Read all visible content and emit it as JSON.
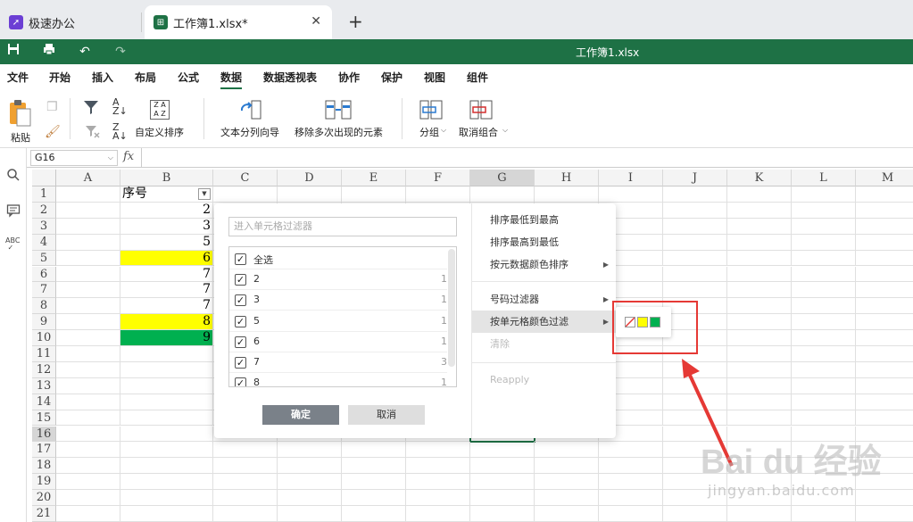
{
  "tabs": [
    {
      "label": "极速办公",
      "active": false
    },
    {
      "label": "工作簿1.xlsx*",
      "active": true
    }
  ],
  "new_tab_symbol": "+",
  "window_title": "工作簿1.xlsx",
  "menu": [
    "文件",
    "开始",
    "插入",
    "布局",
    "公式",
    "数据",
    "数据透视表",
    "协作",
    "保护",
    "视图",
    "组件"
  ],
  "active_menu": "数据",
  "ribbon": {
    "paste": "粘贴",
    "custom_sort": "自定义排序",
    "text_to_columns": "文本分列向导",
    "remove_duplicates": "移除多次出现的元素",
    "group": "分组",
    "ungroup": "取消组合"
  },
  "namebox": "G16",
  "fx": "fx",
  "columns": [
    "A",
    "B",
    "C",
    "D",
    "E",
    "F",
    "G",
    "H",
    "I",
    "J",
    "K",
    "L",
    "M"
  ],
  "selected_column": "G",
  "rows": [
    "1",
    "2",
    "3",
    "4",
    "5",
    "6",
    "7",
    "8",
    "9",
    "10",
    "11",
    "12",
    "13",
    "14",
    "15",
    "16",
    "17",
    "18",
    "19",
    "20",
    "21"
  ],
  "selected_row": "16",
  "b_header": "序号",
  "b_values": [
    {
      "value": "2",
      "fill": ""
    },
    {
      "value": "3",
      "fill": ""
    },
    {
      "value": "5",
      "fill": ""
    },
    {
      "value": "6",
      "fill": "#ffff00"
    },
    {
      "value": "7",
      "fill": ""
    },
    {
      "value": "7",
      "fill": ""
    },
    {
      "value": "7",
      "fill": ""
    },
    {
      "value": "8",
      "fill": "#ffff00"
    },
    {
      "value": "9",
      "fill": "#00b050"
    }
  ],
  "filter": {
    "search_placeholder": "进入单元格过滤器",
    "items": [
      {
        "label": "全选",
        "count": ""
      },
      {
        "label": "2",
        "count": "1"
      },
      {
        "label": "3",
        "count": "1"
      },
      {
        "label": "5",
        "count": "1"
      },
      {
        "label": "6",
        "count": "1"
      },
      {
        "label": "7",
        "count": "3"
      },
      {
        "label": "8",
        "count": "1"
      }
    ],
    "ok": "确定",
    "cancel": "取消",
    "sort_asc": "排序最低到最高",
    "sort_desc": "排序最高到最低",
    "sort_color": "按元数据颜色排序",
    "number_filter": "号码过滤器",
    "color_filter": "按单元格颜色过滤",
    "clear": "清除",
    "reapply": "Reapply"
  },
  "color_options": [
    "none",
    "#ffff00",
    "#00b050"
  ],
  "colors": {
    "brand_green": "#1e7145",
    "highlight": "#e53935"
  },
  "watermark": {
    "brand": "Bai du 经验",
    "url": "jingyan.baidu.com"
  }
}
